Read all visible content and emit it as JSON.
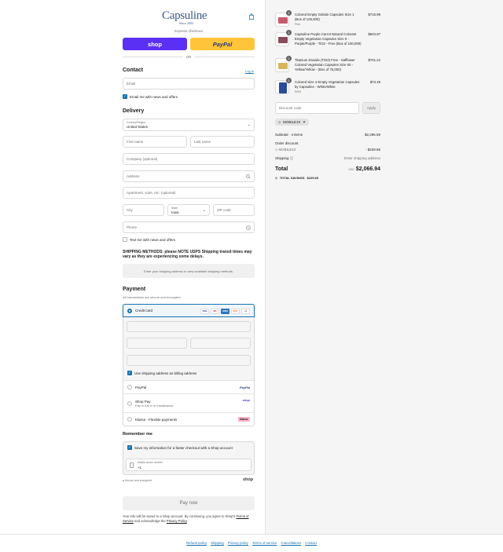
{
  "brand": {
    "name": "Capsuline",
    "since": "Since 2003"
  },
  "express": {
    "label": "Express checkout",
    "shop_label": "shop",
    "paypal_label": "PayPal",
    "or_label": "OR"
  },
  "contact": {
    "title": "Contact",
    "login_label": "Log in",
    "email_placeholder": "Email",
    "email_news_label": "Email me with news and offers"
  },
  "delivery": {
    "title": "Delivery",
    "country_label": "Country/Region",
    "country_value": "United States",
    "first_name": "First name",
    "last_name": "Last name",
    "company": "Company (optional)",
    "address": "Address",
    "apartment": "Apartment, suite, etc. (optional)",
    "city": "City",
    "state_label": "State",
    "state_value": "Iowa",
    "zip": "ZIP code",
    "phone": "Phone",
    "text_news_label": "Text me with news and offers"
  },
  "shipping": {
    "notice": "SHIPPING METHODS: please NOTE USPS Shipping transit times may vary as they are experiencing some delays.",
    "placeholder": "Enter your shipping address to view available shipping methods."
  },
  "payment": {
    "title": "Payment",
    "subtitle": "All transactions are secure and encrypted.",
    "credit_card_label": "Credit card",
    "card_brands": [
      "VISA",
      "MC",
      "AMEX",
      "DISC",
      "+4"
    ],
    "billing_same_label": "Use shipping address as billing address",
    "paypal_label": "PayPal",
    "shoppay_label": "Shop Pay",
    "shoppay_sub": "Pay in full or in installments",
    "shoppay_logo": "shop",
    "klarna_label": "Klarna - Flexible payments",
    "klarna_logo": "Klarna."
  },
  "remember": {
    "title": "Remember me",
    "save_label": "Save my information for a faster checkout with a Shop account",
    "phone_label": "Mobile phone number",
    "phone_value": "+1",
    "secure_label": "Secure and encrypted",
    "shop_label": "shop"
  },
  "pay_now_label": "Pay now",
  "legal": {
    "text1": "Your info will be saved to a Shop account. By continuing, you agree to Shop's",
    "tos": "Terms of Service",
    "text2": "and acknowledge the",
    "privacy": "Privacy Policy",
    "text3": "."
  },
  "order": {
    "items": [
      {
        "qty": "1",
        "name": "Colored Empty Gelatin Capsules Size 1 (Box of 125,000)",
        "variant": "Pink",
        "price": "$716.99"
      },
      {
        "qty": "1",
        "name": "Capsuline Purple Carrot Natural Colorant Empty Vegetarian Capsules Size 0 - Purple/Purple - TiO2 - Free (Box of 100,000)",
        "variant": "",
        "price": "$604.87"
      },
      {
        "qty": "1",
        "name": "Titanium Dioxide (TiO2) Free - Safflower Colored Vegetarian Capsules Size 00 - Yellow/Yellow - (Box of 75,000)",
        "variant": "",
        "price": "$701.24"
      },
      {
        "qty": "1",
        "name": "Colored Size 4 Empty Vegetarian Capsules by Capsuline - White/White",
        "variant": "5000",
        "price": "$73.49"
      }
    ],
    "discount_placeholder": "Discount code",
    "apply_label": "Apply",
    "code_tag": "MOBILE10",
    "subtotal_label": "Subtotal · 4 items",
    "subtotal_value": "$2,296.59",
    "order_discount_label": "Order discount",
    "discount_code": "MOBILE10",
    "discount_value": "- $229.65",
    "shipping_label": "Shipping",
    "shipping_value": "Enter shipping address",
    "total_label": "Total",
    "currency": "USD",
    "total_value": "$2,066.94",
    "savings_label": "TOTAL SAVINGS",
    "savings_value": "$229.65"
  },
  "footer": {
    "links": [
      "Refund policy",
      "Shipping",
      "Privacy policy",
      "Terms of service",
      "Cancellations",
      "Contact"
    ]
  },
  "colors": {
    "accent": "#1773b0",
    "shop": "#5a31f4",
    "paypal": "#ffc439"
  }
}
